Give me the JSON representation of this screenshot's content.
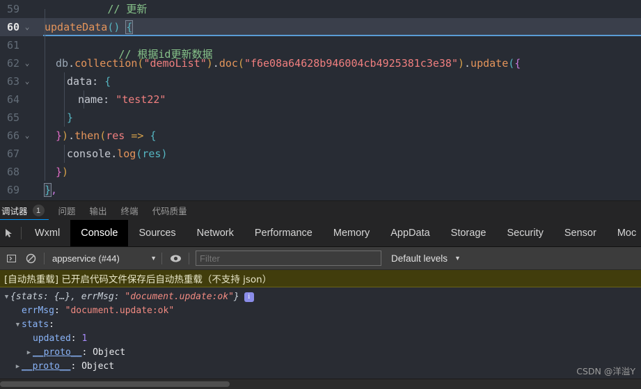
{
  "editor": {
    "lines": [
      {
        "num": "59",
        "fold": false,
        "active": false,
        "text": "  // 更新"
      },
      {
        "num": "60",
        "fold": true,
        "active": true,
        "text": "  updateData() {"
      },
      {
        "num": "61",
        "fold": false,
        "active": false,
        "text": "    // 根据id更新数据"
      },
      {
        "num": "62",
        "fold": true,
        "active": false,
        "text": "    db.collection(\"demoList\").doc(\"f6e08a64628b946004cb4925381c3e38\").update({"
      },
      {
        "num": "63",
        "fold": true,
        "active": false,
        "text": "      data: {"
      },
      {
        "num": "64",
        "fold": false,
        "active": false,
        "text": "        name: \"test22\""
      },
      {
        "num": "65",
        "fold": false,
        "active": false,
        "text": "      }"
      },
      {
        "num": "66",
        "fold": true,
        "active": false,
        "text": "    }).then(res => {"
      },
      {
        "num": "67",
        "fold": false,
        "active": false,
        "text": "      console.log(res)"
      },
      {
        "num": "68",
        "fold": false,
        "active": false,
        "text": "    })"
      },
      {
        "num": "69",
        "fold": false,
        "active": false,
        "text": "  },"
      }
    ],
    "comment_update": "// 更新",
    "comment_byid": "// 根据id更新数据",
    "fn_name": "updateData",
    "collection_name": "demoList",
    "doc_id": "f6e08a64628b946004cb4925381c3e38",
    "data_key": "data",
    "name_key": "name",
    "name_value": "test22",
    "then_keyword": "then",
    "res_param": "res",
    "console_obj": "console",
    "log_method": "log"
  },
  "panel_tabs": {
    "items": [
      {
        "label": "调试器",
        "selected": true,
        "badge": "1"
      },
      {
        "label": "问题",
        "selected": false,
        "badge": ""
      },
      {
        "label": "输出",
        "selected": false,
        "badge": ""
      },
      {
        "label": "终端",
        "selected": false,
        "badge": ""
      },
      {
        "label": "代码质量",
        "selected": false,
        "badge": ""
      }
    ]
  },
  "devtools": {
    "tabs": [
      {
        "label": "Wxml",
        "selected": false
      },
      {
        "label": "Console",
        "selected": true
      },
      {
        "label": "Sources",
        "selected": false
      },
      {
        "label": "Network",
        "selected": false
      },
      {
        "label": "Performance",
        "selected": false
      },
      {
        "label": "Memory",
        "selected": false
      },
      {
        "label": "AppData",
        "selected": false
      },
      {
        "label": "Storage",
        "selected": false
      },
      {
        "label": "Security",
        "selected": false
      },
      {
        "label": "Sensor",
        "selected": false
      },
      {
        "label": "Moc",
        "selected": false
      }
    ]
  },
  "console_toolbar": {
    "context_value": "appservice (#44)",
    "filter_placeholder": "Filter",
    "filter_value": "",
    "levels_label": "Default levels",
    "clear_icon": "clear-console-icon",
    "eye_icon": "eye-icon",
    "sidebar_icon": "console-sidebar-icon"
  },
  "warning": {
    "text": "[自动热重载] 已开启代码文件保存后自动热重载（不支持 json）"
  },
  "console_output": {
    "rows": [
      {
        "indent": 0,
        "arrow": "down",
        "segments": [
          {
            "t": "{stats: {…}, errMsg: ",
            "c": "c-key-it"
          },
          {
            "t": "\"document.update:ok\"",
            "c": "c-str-it"
          },
          {
            "t": "}",
            "c": "c-key-it"
          }
        ],
        "badge": "i"
      },
      {
        "indent": 1,
        "arrow": "none",
        "segments": [
          {
            "t": "errMsg",
            "c": "c-key"
          },
          {
            "t": ": ",
            "c": "c-plain"
          },
          {
            "t": "\"document.update:ok\"",
            "c": "c-str"
          }
        ],
        "badge": ""
      },
      {
        "indent": 1,
        "arrow": "down",
        "segments": [
          {
            "t": "stats",
            "c": "c-key"
          },
          {
            "t": ":",
            "c": "c-plain"
          }
        ],
        "badge": ""
      },
      {
        "indent": 2,
        "arrow": "none",
        "segments": [
          {
            "t": "updated",
            "c": "c-key"
          },
          {
            "t": ": ",
            "c": "c-plain"
          },
          {
            "t": "1",
            "c": "c-num"
          }
        ],
        "badge": ""
      },
      {
        "indent": 2,
        "arrow": "right",
        "segments": [
          {
            "t": "__proto__",
            "c": "c-proto"
          },
          {
            "t": ": ",
            "c": "c-plain"
          },
          {
            "t": "Object",
            "c": "c-obj"
          }
        ],
        "badge": ""
      },
      {
        "indent": 1,
        "arrow": "right",
        "segments": [
          {
            "t": "__proto__",
            "c": "c-proto"
          },
          {
            "t": ": ",
            "c": "c-plain"
          },
          {
            "t": "Object",
            "c": "c-obj"
          }
        ],
        "badge": ""
      }
    ]
  },
  "watermark": {
    "text": "CSDN @洋溢Y"
  },
  "colors": {
    "editor_bg": "#282c34",
    "console_bg": "#292c33",
    "accent_blue": "#0097fb",
    "warn_bg": "#413d0c",
    "selected_tab_bg": "#000000",
    "string_red": "#f07f7f",
    "comment_green": "#87c38a",
    "function_orange": "#e5955b"
  }
}
